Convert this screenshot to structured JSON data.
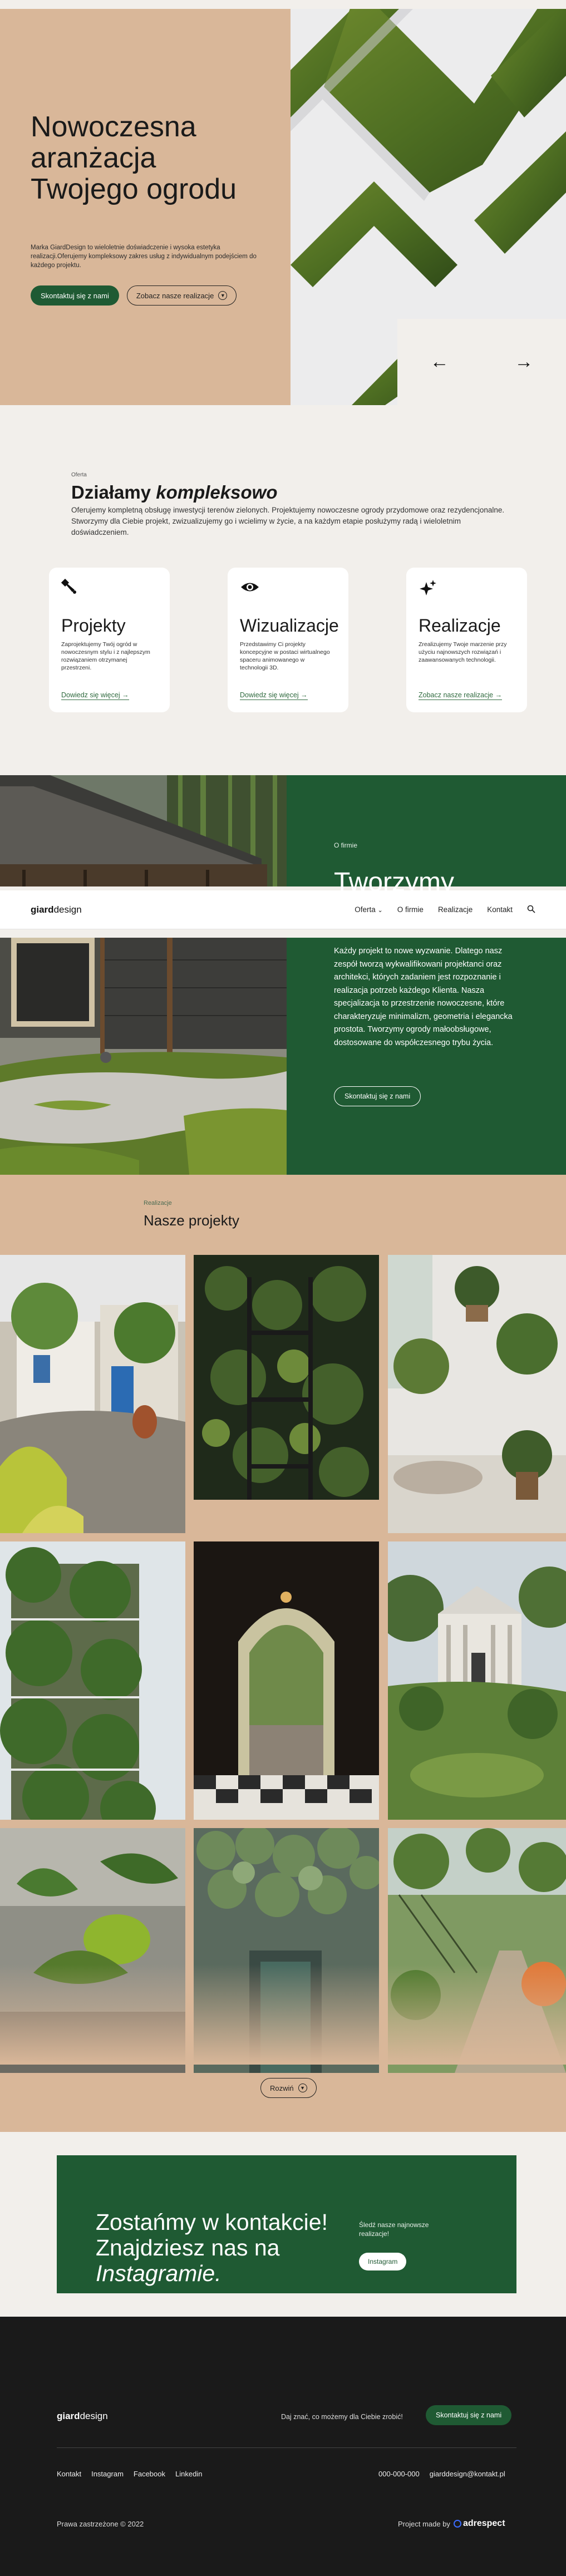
{
  "hero": {
    "title": "Nowoczesna aranżacja Twojego ogrodu",
    "description": "Marka GiardDesign to wieloletnie doświadczenie i wysoka estetyka realizacji.Oferujemy kompleksowy zakres usług z indywidualnym podejściem do każdego projektu.",
    "contact_button": "Skontaktuj się z nami",
    "realizations_button": "Zobacz nasze realizacje",
    "prev_arrow": "←",
    "next_arrow": "→"
  },
  "offer": {
    "eyebrow": "Oferta",
    "title_plain": "Działamy ",
    "title_emph": "kompleksowo",
    "description": "Oferujemy kompletną obsługę inwestycji terenów zielonych. Projektujemy nowoczesne ogrody przydomowe oraz rezydencjonalne. Stworzymy dla Ciebie projekt, zwizualizujemy go i wcielimy w życie, a na każdym etapie posłużymy radą i wieloletnim doświadczeniem.",
    "cards": [
      {
        "icon": "pen-tool-icon",
        "title": "Projekty",
        "text": "Zaprojektujemy Twój ogród w nowoczesnym stylu i z najlepszym rozwiązaniem otrzymanej przestrzeni.",
        "link": "Dowiedz się więcej"
      },
      {
        "icon": "eye-icon",
        "title": "Wizualizacje",
        "text": "Przedstawimy Ci projekty koncepcyjne w postaci wirtualnego spaceru animowanego w technologii 3D.",
        "link": "Dowiedz się więcej"
      },
      {
        "icon": "sparkles-icon",
        "title": "Realizacje",
        "text": "Zrealizujemy Twoje marzenie przy użyciu najnowszych rozwiązań i zaawansowanych technologii.",
        "link": "Zobacz nasze realizacje"
      }
    ]
  },
  "about": {
    "label": "O firmie",
    "big_title": "Tworzymy",
    "text": "Każdy projekt to nowe wyzwanie. Dlatego nasz zespół tworzą wykwalifikowani projektanci oraz architekci, których zadaniem jest rozpoznanie i realizacja potrzeb każdego Klienta. Nasza specjalizacja to przestrzenie nowoczesne, które charakteryzuje minimalizm, geometria i elegancka prostota. Tworzymy ogrody małoobsługowe, dostosowane do współczesnego trybu życia.",
    "button": "Skontaktuj się z nami"
  },
  "nav": {
    "logo_bold": "giard",
    "logo_light": "design",
    "links": [
      "Oferta",
      "O firmie",
      "Realizacje",
      "Kontakt"
    ],
    "dropdown_caret": "⌄",
    "search_icon": "search-icon"
  },
  "projects": {
    "eyebrow": "Realizacje",
    "title": "Nasze projekty",
    "expand_button": "Rozwiń"
  },
  "contact": {
    "title_line1": "Zostańmy w kontakcie!",
    "title_line2": "Znajdziesz nas na",
    "title_emph": "Instagramie.",
    "side_text": "Śledź nasze najnowsze realizacje!",
    "button": "Instagram"
  },
  "footer": {
    "logo_bold": "giard",
    "logo_light": "design",
    "question": "Daj znać, co możemy dla Ciebie zrobić!",
    "button": "Skontaktuj się z nami",
    "links": [
      "Kontakt",
      "Instagram",
      "Facebook",
      "Linkedin"
    ],
    "phone": "000-000-000",
    "email": "giarddesign@kontakt.pl",
    "copyright": "Prawa zastrzeżone © 2022",
    "made_by": "Project made by",
    "agency": "adrespect"
  },
  "colors": {
    "green": "#1f5a33",
    "beige": "#d9b799",
    "cream": "#f2efeb",
    "dark": "#1a1a1a"
  }
}
